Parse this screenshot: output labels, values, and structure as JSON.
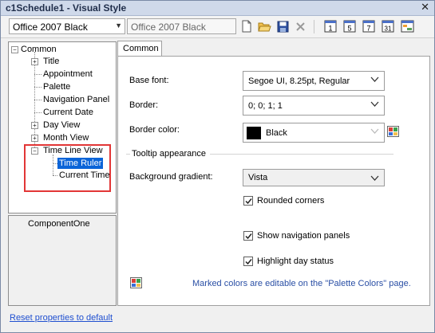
{
  "window": {
    "title": "c1Schedule1 - Visual Style",
    "close_glyph": "✕"
  },
  "toolbar": {
    "theme_select": "Office 2007 Black",
    "theme_name_input": "Office 2007 Black",
    "view_buttons": [
      "1",
      "5",
      "7",
      "31"
    ]
  },
  "tree": {
    "root": "Common",
    "items": [
      {
        "label": "Title"
      },
      {
        "label": "Appointment"
      },
      {
        "label": "Palette"
      },
      {
        "label": "Navigation Panel"
      },
      {
        "label": "Current Date"
      },
      {
        "label": "Day View"
      },
      {
        "label": "Month View"
      },
      {
        "label": "Time Line View"
      },
      {
        "label": "Time Ruler"
      },
      {
        "label": "Current Time"
      }
    ],
    "highlight_color": "#e23636",
    "selected_color": "#0a64d8"
  },
  "logo_label": "ComponentOne",
  "tab": {
    "label": "Common"
  },
  "form": {
    "base_font": {
      "label": "Base font:",
      "value": "Segoe UI, 8.25pt, Regular"
    },
    "border": {
      "label": "Border:",
      "value": "0; 0; 1; 1"
    },
    "border_color": {
      "label": "Border color:",
      "value": "Black"
    },
    "tooltip_group": "Tooltip appearance",
    "background_gradient": {
      "label": "Background gradient:",
      "value": "Vista"
    },
    "rounded_corners": {
      "label": "Rounded corners",
      "checked": true
    },
    "show_navigation_panels": {
      "label": "Show navigation panels",
      "checked": true
    },
    "highlight_day_status": {
      "label": "Highlight day status",
      "checked": true
    },
    "palette_hint": "Marked colors are editable on the \"Palette Colors\" page."
  },
  "footer": {
    "reset_link": "Reset properties to default"
  }
}
